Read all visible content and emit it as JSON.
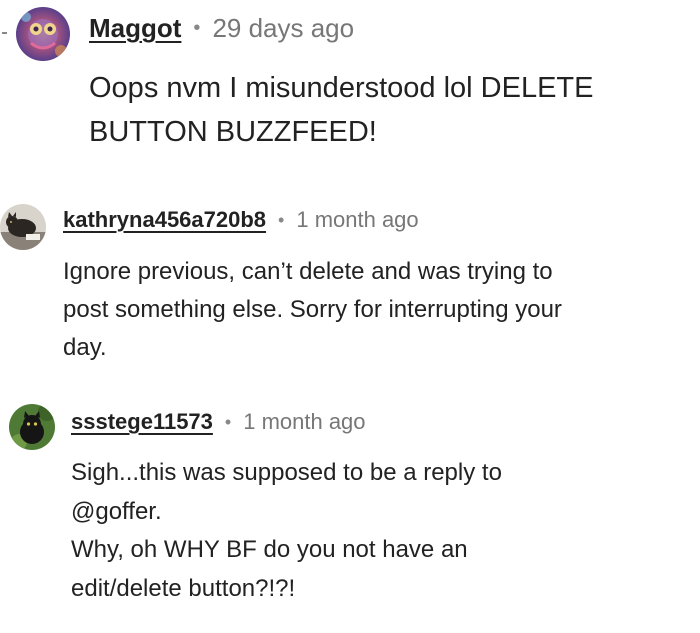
{
  "comments": [
    {
      "username": "Maggot",
      "separator": "•",
      "time": "29 days ago",
      "lines": [
        "Oops nvm I misunderstood lol DELETE",
        "BUTTON BUZZFEED!"
      ],
      "avatar_icon": "psychedelic-art-avatar-icon"
    },
    {
      "username": "kathryna456a720b8",
      "separator": "•",
      "time": "1 month ago",
      "lines": [
        "Ignore previous, can’t delete and was trying to",
        "post something else. Sorry for interrupting your",
        "day."
      ],
      "avatar_icon": "cat-photo-avatar-icon"
    },
    {
      "username": "ssstege11573",
      "separator": "•",
      "time": "1 month ago",
      "lines": [
        "Sigh...this was supposed to be a reply to",
        "@goffer.",
        "Why, oh WHY BF do you not have an",
        "edit/delete button?!?!"
      ],
      "avatar_icon": "black-cat-avatar-icon"
    }
  ],
  "colors": {
    "text": "#222222",
    "meta": "#777777",
    "background": "#ffffff"
  }
}
